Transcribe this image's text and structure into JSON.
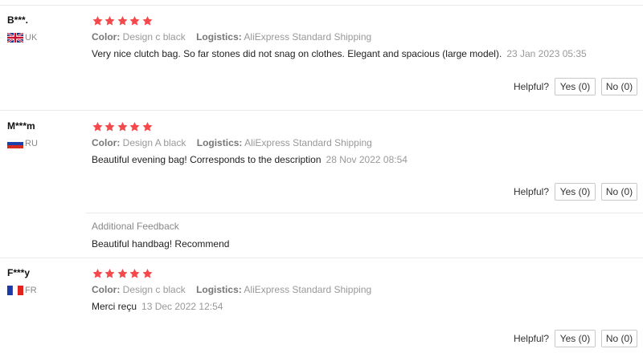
{
  "reviews": [
    {
      "user": "B***.",
      "country": "UK",
      "color_label": "Color:",
      "color_value": "Design c black",
      "logistics_label": "Logistics:",
      "logistics_value": "AliExpress Standard Shipping",
      "text": "Very nice clutch bag. So far stones did not snag on clothes. Elegant and spacious (large model).",
      "date": "23 Jan 2023 05:35",
      "helpful_label": "Helpful?",
      "yes_label": "Yes (0)",
      "no_label": "No (0)",
      "rating": 5
    },
    {
      "user": "M***m",
      "country": "RU",
      "color_label": "Color:",
      "color_value": "Design A black",
      "logistics_label": "Logistics:",
      "logistics_value": "AliExpress Standard Shipping",
      "text": "Beautiful evening bag! Corresponds to the description",
      "date": "28 Nov 2022 08:54",
      "helpful_label": "Helpful?",
      "yes_label": "Yes (0)",
      "no_label": "No (0)",
      "rating": 5,
      "additional_feedback_title": "Additional Feedback",
      "additional_feedback_text": "Beautiful handbag! Recommend"
    },
    {
      "user": "F***y",
      "country": "FR",
      "color_label": "Color:",
      "color_value": "Design c black",
      "logistics_label": "Logistics:",
      "logistics_value": "AliExpress Standard Shipping",
      "text": "Merci reçu",
      "date": "13 Dec 2022 12:54",
      "helpful_label": "Helpful?",
      "yes_label": "Yes (0)",
      "no_label": "No (0)",
      "rating": 5
    }
  ],
  "colors": {
    "star": "#f5484b",
    "muted": "#999999",
    "border": "#e8e8e8"
  }
}
